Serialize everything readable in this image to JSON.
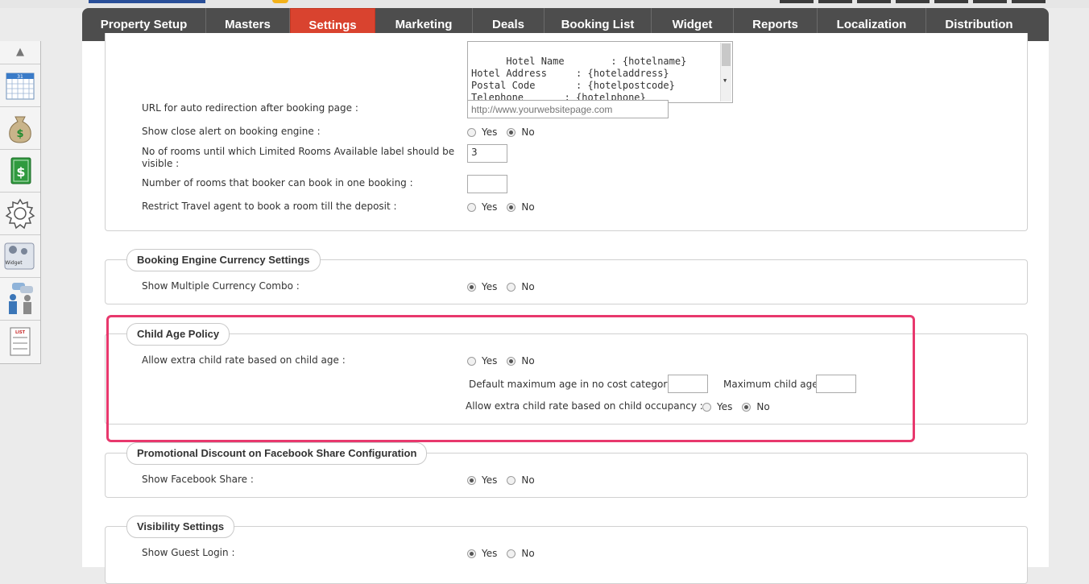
{
  "nav": {
    "tabs": [
      {
        "label": "Property Setup",
        "active": false
      },
      {
        "label": "Masters",
        "active": false
      },
      {
        "label": "Settings",
        "active": true
      },
      {
        "label": "Marketing",
        "active": false
      },
      {
        "label": "Deals",
        "active": false
      },
      {
        "label": "Booking List",
        "active": false
      },
      {
        "label": "Widget",
        "active": false
      },
      {
        "label": "Reports",
        "active": false
      },
      {
        "label": "Localization",
        "active": false
      },
      {
        "label": "Distribution",
        "active": false
      }
    ],
    "active_color": "#d9432f"
  },
  "sidebar": {
    "items": [
      {
        "icon": "calendar-icon",
        "text": "31"
      },
      {
        "icon": "money-bag-icon",
        "text": "$"
      },
      {
        "icon": "dollar-bill-icon",
        "text": "$"
      },
      {
        "icon": "gear-icon"
      },
      {
        "icon": "widget-icon",
        "text": "Widget"
      },
      {
        "icon": "users-chat-icon"
      },
      {
        "icon": "list-icon",
        "text": "LIST"
      }
    ]
  },
  "top_section": {
    "template_text": "Hotel Name        : {hotelname}\nHotel Address     : {hoteladdress}\nPostal Code       : {hotelpostcode}\nTelephone       : {hotelphone}\nFax        : {hotelfax}",
    "rows": {
      "redirect_label": "URL for auto redirection after booking page :",
      "redirect_placeholder": "http://www.yourwebsitepage.com",
      "close_alert_label": "Show close alert on booking engine :",
      "limited_rooms_label": "No of rooms until which Limited Rooms Available label should be visible :",
      "limited_rooms_value": "3",
      "rooms_per_booking_label": "Number of rooms that booker can book in one booking :",
      "rooms_per_booking_value": "",
      "restrict_ta_label": "Restrict Travel agent to book a room till the deposit :"
    }
  },
  "options": {
    "yes": "Yes",
    "no": "No"
  },
  "currency_section": {
    "title": "Booking Engine Currency Settings",
    "label": "Show Multiple Currency Combo :"
  },
  "child_age_section": {
    "title": "Child Age Policy",
    "label": "Allow extra child rate based on child age :",
    "default_max_age_label": "Default maximum age in no cost category",
    "default_max_age_value": "",
    "max_child_age_label": "Maximum child age",
    "max_child_age_value": "",
    "occupancy_label": "Allow extra child rate based on child occupancy :"
  },
  "facebook_section": {
    "title": "Promotional Discount on Facebook Share Configuration",
    "label": "Show Facebook Share :"
  },
  "visibility_section": {
    "title": "Visibility Settings",
    "label": "Show Guest Login :"
  },
  "highlight_color": "#e8386d"
}
